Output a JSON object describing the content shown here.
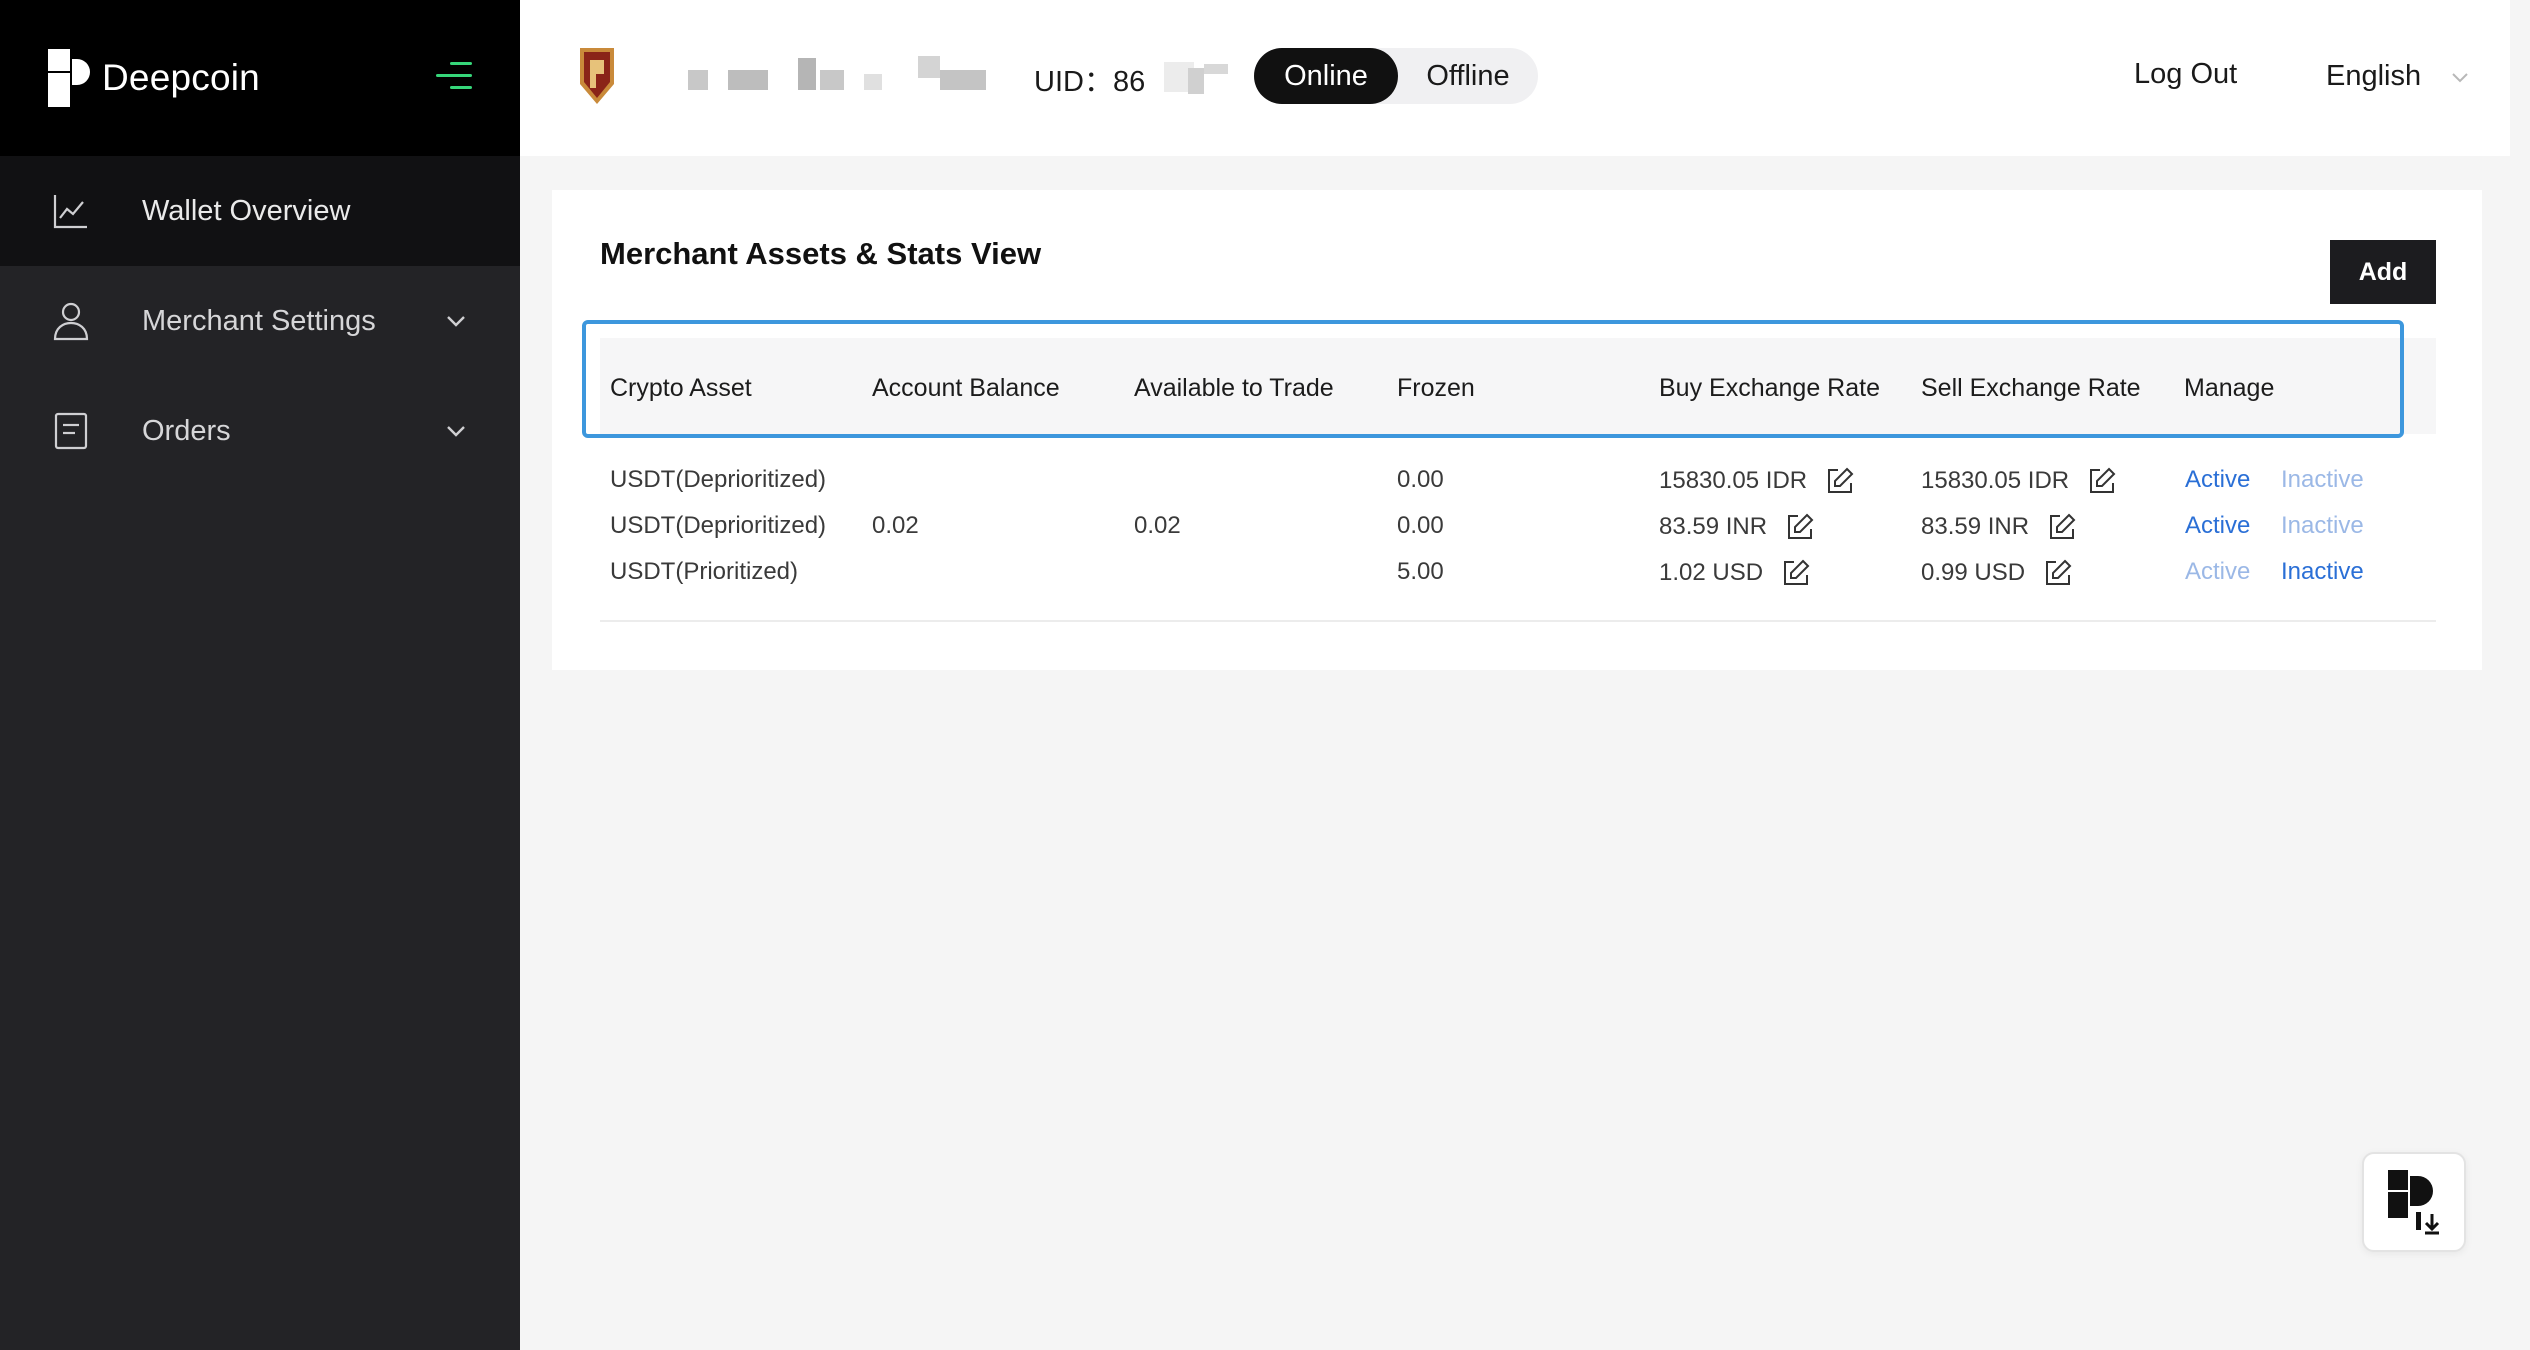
{
  "brand": {
    "name": "Deepcoin"
  },
  "sidebar": {
    "items": [
      {
        "label": "Wallet Overview",
        "icon": "chart-line-icon",
        "active": true,
        "expandable": false
      },
      {
        "label": "Merchant Settings",
        "icon": "user-icon",
        "active": false,
        "expandable": true
      },
      {
        "label": "Orders",
        "icon": "document-icon",
        "active": false,
        "expandable": true
      }
    ]
  },
  "header": {
    "uid_label": "UID：",
    "uid_value": "86",
    "status": {
      "online_label": "Online",
      "offline_label": "Offline",
      "selected": "Online"
    },
    "logout_label": "Log Out",
    "language": "English"
  },
  "main": {
    "title": "Merchant Assets & Stats View",
    "add_label": "Add",
    "columns": [
      "Crypto Asset",
      "Account Balance",
      "Available to Trade",
      "Frozen",
      "Buy Exchange Rate",
      "Sell Exchange Rate",
      "Manage"
    ],
    "rows": [
      {
        "asset": "USDT(Deprioritized)",
        "balance": "",
        "available": "",
        "frozen": "0.00",
        "buy_rate": "15830.05 IDR",
        "sell_rate": "15830.05 IDR",
        "active_label": "Active",
        "inactive_label": "Inactive",
        "state": "active"
      },
      {
        "asset": "USDT(Deprioritized)",
        "balance": "0.02",
        "available": "0.02",
        "frozen": "0.00",
        "buy_rate": "83.59 INR",
        "sell_rate": "83.59 INR",
        "active_label": "Active",
        "inactive_label": "Inactive",
        "state": "active"
      },
      {
        "asset": "USDT(Prioritized)",
        "balance": "",
        "available": "",
        "frozen": "5.00",
        "buy_rate": "1.02 USD",
        "sell_rate": "0.99 USD",
        "active_label": "Active",
        "inactive_label": "Inactive",
        "state": "inactive"
      }
    ]
  },
  "colors": {
    "sidebar_bg": "#232326",
    "brand_bg": "#000000",
    "accent_green": "#36d67a",
    "link_blue": "#2a6fd6",
    "highlight_blue": "#3d97dd"
  }
}
